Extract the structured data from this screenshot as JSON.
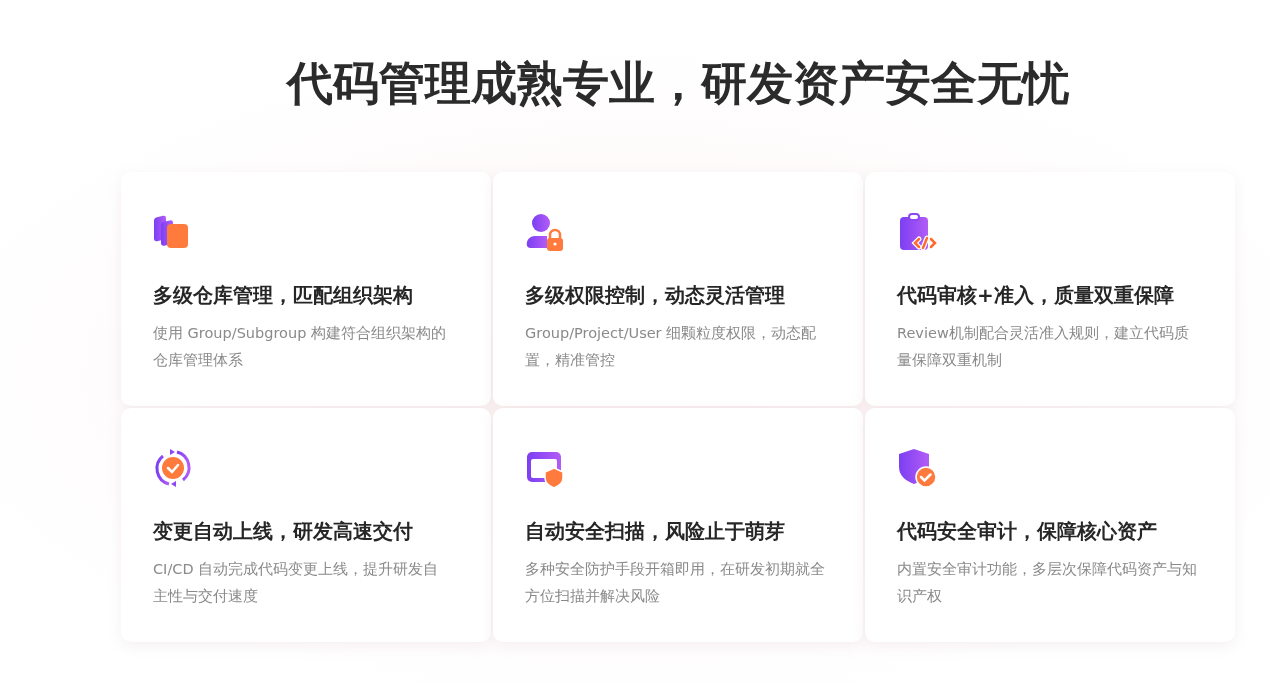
{
  "title": "代码管理成熟专业，研发资产安全无忧",
  "cards": [
    {
      "heading": "多级仓库管理，匹配组织架构",
      "description": "使用 Group/Subgroup 构建符合组织架构的仓库管理体系"
    },
    {
      "heading": "多级权限控制，动态灵活管理",
      "description": "Group/Project/User 细颗粒度权限，动态配置，精准管控"
    },
    {
      "heading": "代码审核+准入，质量双重保障",
      "description": "Review机制配合灵活准入规则，建立代码质量保障双重机制"
    },
    {
      "heading": "变更自动上线，研发高速交付",
      "description": "CI/CD 自动完成代码变更上线，提升研发自主性与交付速度"
    },
    {
      "heading": "自动安全扫描，风险止于萌芽",
      "description": "多种安全防护手段开箱即用，在研发初期就全方位扫描并解决风险"
    },
    {
      "heading": "代码安全审计，保障核心资产",
      "description": "内置安全审计功能，多层次保障代码资产与知识产权"
    }
  ]
}
